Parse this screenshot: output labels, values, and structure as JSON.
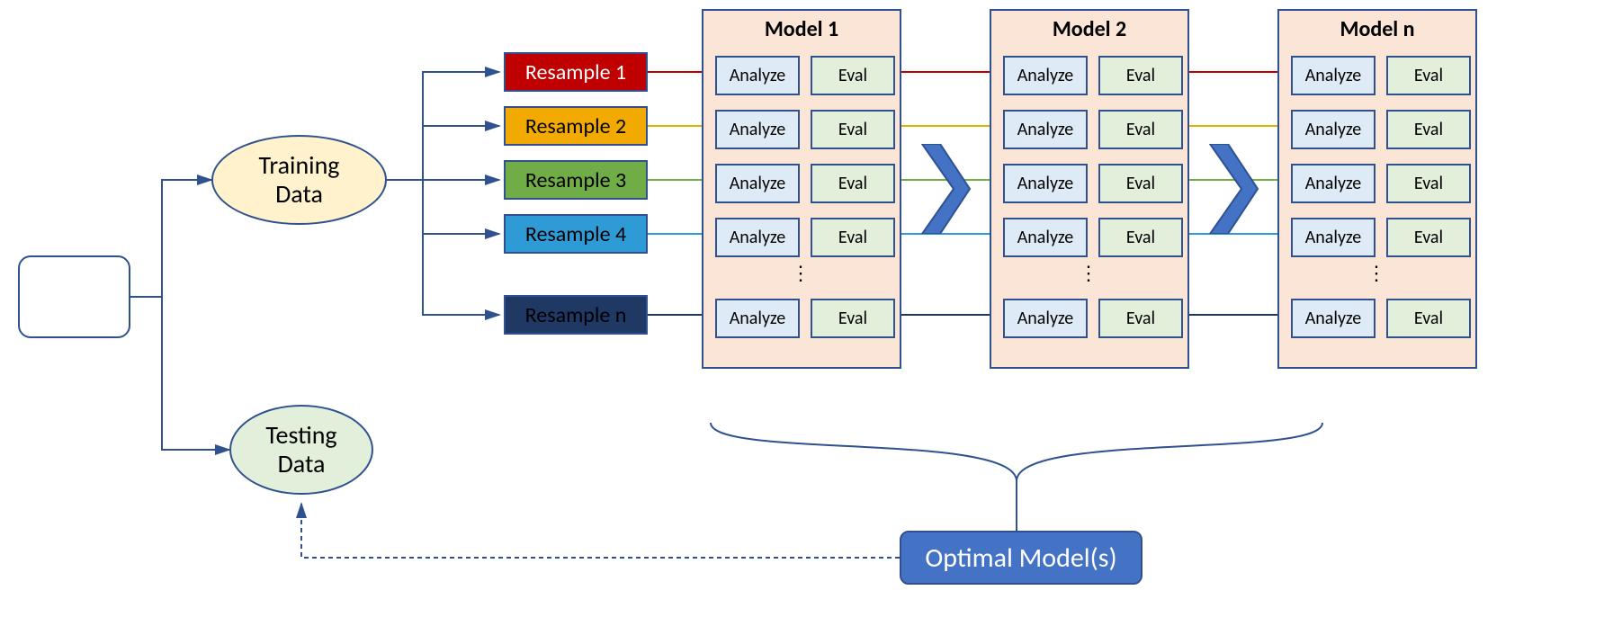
{
  "source_box": "",
  "training_label": "Training\nData",
  "testing_label": "Testing\nData",
  "resamples": [
    {
      "label": "Resample 1",
      "bg": "#c00000",
      "fg": "#ffffff",
      "line": "#c00000"
    },
    {
      "label": "Resample 2",
      "bg": "#f2a900",
      "fg": "#000000",
      "line": "#e3b100"
    },
    {
      "label": "Resample 3",
      "bg": "#70ad47",
      "fg": "#000000",
      "line": "#70ad47"
    },
    {
      "label": "Resample 4",
      "bg": "#2e9bd6",
      "fg": "#000000",
      "line": "#2e9bd6"
    },
    {
      "label": "Resample n",
      "bg": "#1f3864",
      "fg": "#000000",
      "line": "#1f3864"
    }
  ],
  "models": [
    "Model 1",
    "Model 2",
    "Model n"
  ],
  "ae": {
    "analyze": "Analyze",
    "eval": "Eval"
  },
  "optimal_label": "Optimal Model(s)"
}
